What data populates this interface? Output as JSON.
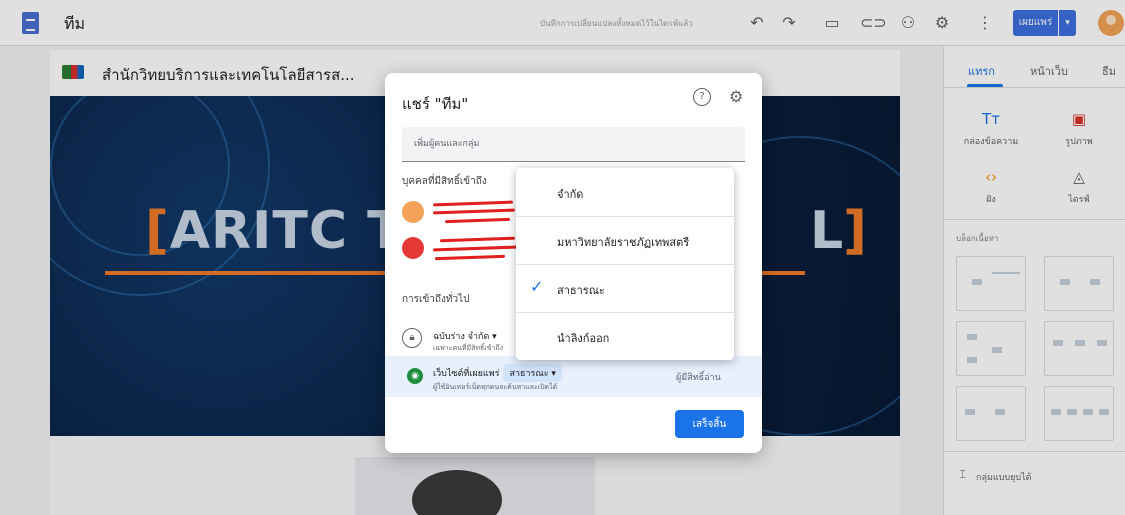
{
  "topbar": {
    "doc_title": "ทีม",
    "save_status": "บันทึกการเปลี่ยนแปลงทั้งหมดไว้ในไดรฟ์แล้ว",
    "publish_label": "เผยแพร่"
  },
  "site": {
    "name": "สำนักวิทยบริการและเทคโนโลยีสารส...",
    "banner_title_left": "ARITC T",
    "banner_title_right": "L"
  },
  "right_panel": {
    "tabs": [
      "แทรก",
      "หน้าเว็บ",
      "ธีม"
    ],
    "insert_items": [
      "กล่องข้อความ",
      "รูปภาพ",
      "ฝัง",
      "ไดรฟ์"
    ],
    "layouts_label": "บล็อกเนื้อหา",
    "bottom_item": "กลุ่มแบบยุบได้"
  },
  "share_dialog": {
    "title": "แชร์ \"ทีม\"",
    "add_placeholder": "เพิ่มผู้คนและกลุ่ม",
    "people_label": "บุคคลที่มีสิทธิ์เข้าถึง",
    "general_access_label": "การเข้าถึงทั่วไป",
    "draft_access": "ฉบับร่าง  จำกัด  ▾",
    "draft_access_sub": "เฉพาะคนที่มีสิทธิ์เข้าถึง",
    "published_label": "เว็บไซต์ที่เผยแพร่",
    "published_value": "สาธารณะ ▾",
    "published_sub": "ผู้ใช้อินเทอร์เน็ตทุกคนจะค้นหาและเปิดได้",
    "published_role": "ผู้มีสิทธิ์อ่าน",
    "done_label": "เสร็จสิ้น"
  },
  "dropdown": {
    "items": [
      "จำกัด",
      "มหาวิทยาลัยราชภัฏเทพสตรี",
      "สาธารณะ",
      "นำลิงก์ออก"
    ],
    "selected": "สาธารณะ"
  },
  "colors": {
    "accent": "#1a73e8",
    "publish": "#3d6fe0",
    "banner": "#0a2447",
    "bracket": "#ef7c2b"
  }
}
